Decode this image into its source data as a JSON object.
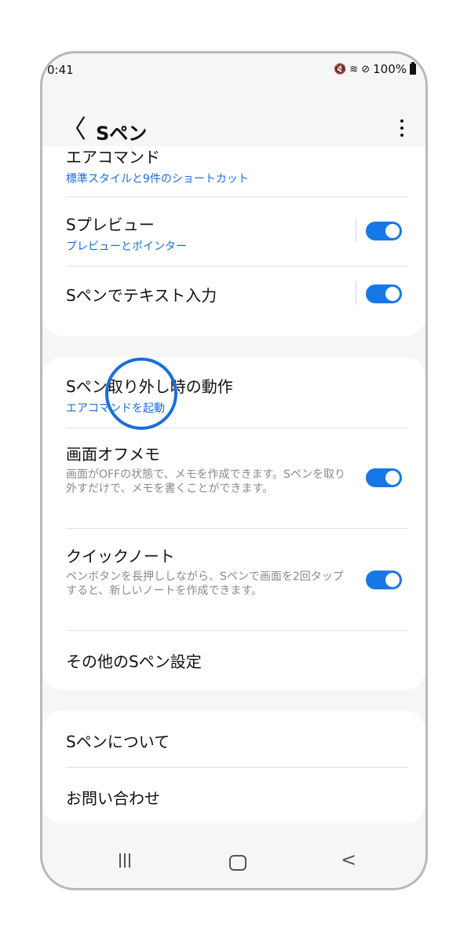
{
  "status": {
    "time": "0:41",
    "battery": "100%",
    "icons": [
      "mute-icon",
      "wifi-icon",
      "no-sync-icon",
      "battery-icon"
    ]
  },
  "appbar": {
    "title": "Sペン",
    "back_glyph": "〈",
    "more": "more-options-icon"
  },
  "group1": {
    "air_command": {
      "label": "エアコマンド",
      "sub": "標準スタイルと9件のショートカット"
    },
    "s_preview": {
      "label": "Sプレビュー",
      "sub": "プレビューとポインター",
      "on": true
    },
    "text_input": {
      "label": "Sペンでテキスト入力",
      "on": true
    }
  },
  "group2": {
    "detach": {
      "label": "Sペン取り外し時の動作",
      "sub": "エアコマンドを起動"
    },
    "screen_off_memo": {
      "label": "画面オフメモ",
      "desc": "画面がOFFの状態で、メモを作成できます。Sペンを取り外すだけで、メモを書くことができます。",
      "on": true
    },
    "quick_note": {
      "label": "クイックノート",
      "desc": "ペンボタンを長押ししながら、Sペンで画面を2回タップすると、新しいノートを作成できます。",
      "on": true
    },
    "other": {
      "label": "その他のSペン設定"
    }
  },
  "group3": {
    "about": {
      "label": "Sペンについて"
    },
    "contact": {
      "label": "お問い合わせ"
    }
  },
  "colors": {
    "accent": "#1877e6",
    "link": "#1a6ed8",
    "background": "#f6f6f6"
  }
}
